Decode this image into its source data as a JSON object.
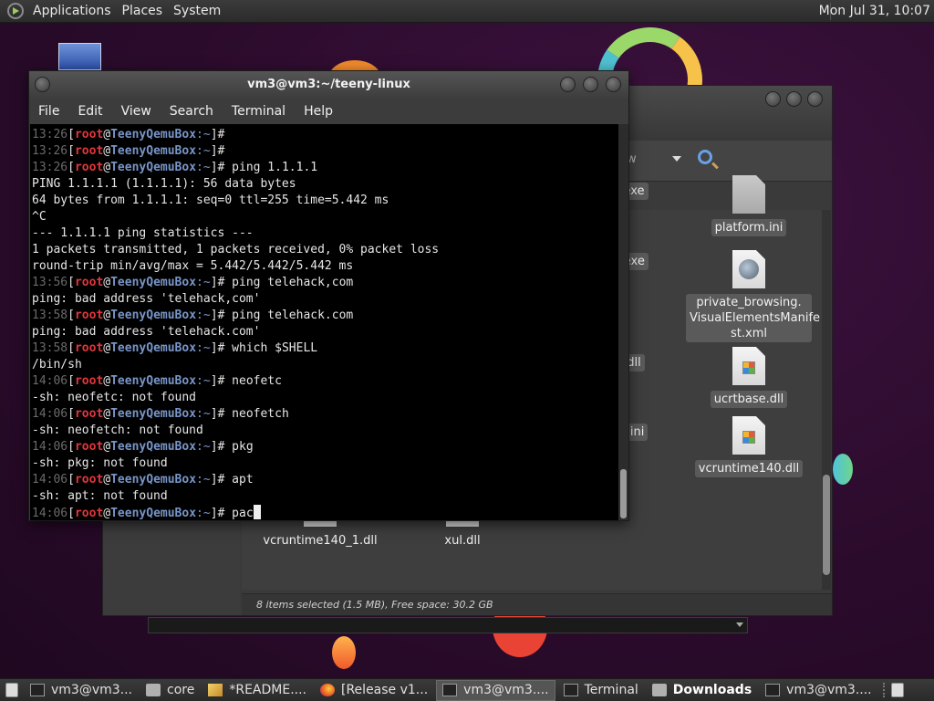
{
  "top_panel": {
    "menus": [
      "Applications",
      "Places",
      "System"
    ],
    "clock": "Mon Jul 31, 10:07"
  },
  "terminal": {
    "title": "vm3@vm3:~/teeny-linux",
    "menu": [
      "File",
      "Edit",
      "View",
      "Search",
      "Terminal",
      "Help"
    ],
    "prompt": {
      "user": "root",
      "at": "@",
      "host": "TeenyQemuBox",
      "path": ":~",
      "suffix": "]# "
    },
    "lines": [
      {
        "type": "prompt",
        "time": "13:26",
        "cmd": ""
      },
      {
        "type": "prompt",
        "time": "13:26",
        "cmd": ""
      },
      {
        "type": "prompt",
        "time": "13:26",
        "cmd": "ping 1.1.1.1"
      },
      {
        "type": "out",
        "text": "PING 1.1.1.1 (1.1.1.1): 56 data bytes"
      },
      {
        "type": "out",
        "text": "64 bytes from 1.1.1.1: seq=0 ttl=255 time=5.442 ms"
      },
      {
        "type": "out",
        "text": "^C"
      },
      {
        "type": "out",
        "text": "--- 1.1.1.1 ping statistics ---"
      },
      {
        "type": "out",
        "text": "1 packets transmitted, 1 packets received, 0% packet loss"
      },
      {
        "type": "out",
        "text": "round-trip min/avg/max = 5.442/5.442/5.442 ms"
      },
      {
        "type": "prompt",
        "time": "13:56",
        "cmd": "ping telehack,com"
      },
      {
        "type": "out",
        "text": "ping: bad address 'telehack,com'"
      },
      {
        "type": "prompt",
        "time": "13:58",
        "cmd": "ping telehack.com"
      },
      {
        "type": "out",
        "text": "ping: bad address 'telehack.com'"
      },
      {
        "type": "prompt",
        "time": "13:58",
        "cmd": "which $SHELL"
      },
      {
        "type": "out",
        "text": "/bin/sh"
      },
      {
        "type": "prompt",
        "time": "14:06",
        "cmd": "neofetc"
      },
      {
        "type": "out",
        "text": "-sh: neofetc: not found"
      },
      {
        "type": "prompt",
        "time": "14:06",
        "cmd": "neofetch"
      },
      {
        "type": "out",
        "text": "-sh: neofetch: not found"
      },
      {
        "type": "prompt",
        "time": "14:06",
        "cmd": "pkg"
      },
      {
        "type": "out",
        "text": "-sh: pkg: not found"
      },
      {
        "type": "prompt",
        "time": "14:06",
        "cmd": "apt"
      },
      {
        "type": "out",
        "text": "-sh: apt: not found"
      },
      {
        "type": "prompt",
        "time": "14:06",
        "cmd": "pac",
        "cursor": true
      }
    ]
  },
  "file_manager": {
    "view_label": "ew",
    "status": "8 items selected (1.5 MB), Free space: 30.2 GB",
    "files": [
      {
        "label": "exe",
        "icon": "none",
        "selected": true
      },
      {
        "label": "platform.ini",
        "icon": "grey",
        "selected": true
      },
      {
        "label": "ng.exe",
        "icon": "none",
        "selected": true
      },
      {
        "label": "private_browsing.\nVisualElementsManife\nst.xml",
        "icon": "globe",
        "selected": true
      },
      {
        "label": "dll",
        "icon": "none",
        "selected": true
      },
      {
        "label": "ucrtbase.dll",
        "icon": "win",
        "selected": true
      },
      {
        "label": "gs.ini",
        "icon": "none",
        "selected": true
      },
      {
        "label": "vcruntime140.dll",
        "icon": "win",
        "selected": true
      },
      {
        "label": "vcruntime140_1.dll",
        "icon": "win",
        "selected": false
      },
      {
        "label": "xul.dll",
        "icon": "win",
        "selected": false
      }
    ]
  },
  "taskbar": {
    "tasks": [
      {
        "label": "vm3@vm3...",
        "icon": "terminal",
        "active": false,
        "bold": false
      },
      {
        "label": "core",
        "icon": "folder",
        "active": false,
        "bold": false
      },
      {
        "label": "*README....",
        "icon": "editor",
        "active": false,
        "bold": false
      },
      {
        "label": "[Release v1...",
        "icon": "firefox",
        "active": false,
        "bold": false
      },
      {
        "label": "vm3@vm3....",
        "icon": "terminal",
        "active": true,
        "bold": false
      },
      {
        "label": "Terminal",
        "icon": "terminal",
        "active": false,
        "bold": false
      },
      {
        "label": "Downloads",
        "icon": "folder",
        "active": false,
        "bold": true
      },
      {
        "label": "vm3@vm3....",
        "icon": "terminal",
        "active": false,
        "bold": false
      }
    ]
  },
  "colors": {
    "prompt_user": "#e2363b",
    "prompt_host": "#7895c8",
    "timestamp": "#6a6a6a",
    "terminal_bg": "#000000"
  }
}
